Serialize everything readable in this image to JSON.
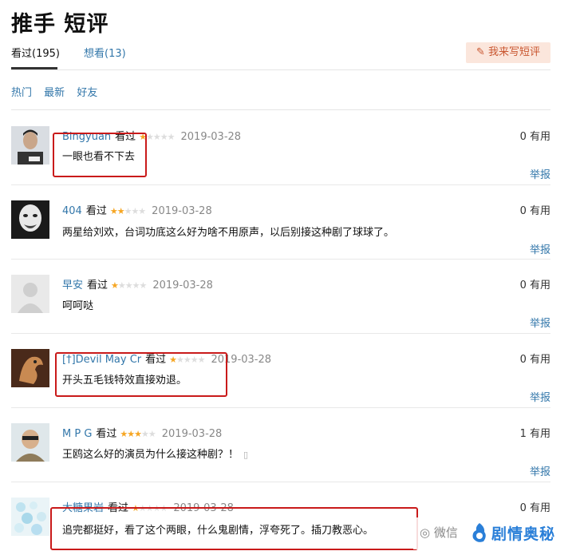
{
  "page": {
    "title": "推手 短评"
  },
  "tabs": [
    {
      "label": "看过(195)"
    },
    {
      "label": "想看(13)"
    }
  ],
  "write_button": {
    "label": "我来写短评"
  },
  "filters": [
    "热门",
    "最新",
    "好友"
  ],
  "comments": [
    {
      "user": "Bingyuan",
      "action": "看过",
      "rating": 1,
      "date": "2019-03-28",
      "useful": "0 有用",
      "text": "一眼也看不下去",
      "report": "举报"
    },
    {
      "user": "404",
      "action": "看过",
      "rating": 2,
      "date": "2019-03-28",
      "useful": "0 有用",
      "text": "两星给刘欢，台词功底这么好为啥不用原声，以后别接这种剧了球球了。",
      "report": "举报"
    },
    {
      "user": "早安",
      "action": "看过",
      "rating": 1,
      "date": "2019-03-28",
      "useful": "0 有用",
      "text": "呵呵哒",
      "report": "举报"
    },
    {
      "user": "[†]Devil May Cr",
      "action": "看过",
      "rating": 1,
      "date": "2019-03-28",
      "useful": "0 有用",
      "text": "开头五毛钱特效直接劝退。",
      "report": "举报"
    },
    {
      "user": "M P G",
      "action": "看过",
      "rating": 3,
      "date": "2019-03-28",
      "useful": "1 有用",
      "text": "王鸥这么好的演员为什么接这种剧？！",
      "report": "举报"
    },
    {
      "user": "大糖果岩",
      "action": "看过",
      "rating": 1,
      "date": "2019-03-28",
      "useful": "0 有用",
      "text": "追完都挺好，看了这个两眼，什么鬼剧情，浮夸死了。插刀教恶心。",
      "report": ""
    }
  ],
  "watermark": {
    "wechat": "微信",
    "brand": "剧情奥秘"
  },
  "colors": {
    "link": "#3377aa",
    "star": "#f6a623",
    "highlight_box": "#c91a1a",
    "button_bg": "#fbe6dc",
    "button_text": "#c9562f"
  }
}
